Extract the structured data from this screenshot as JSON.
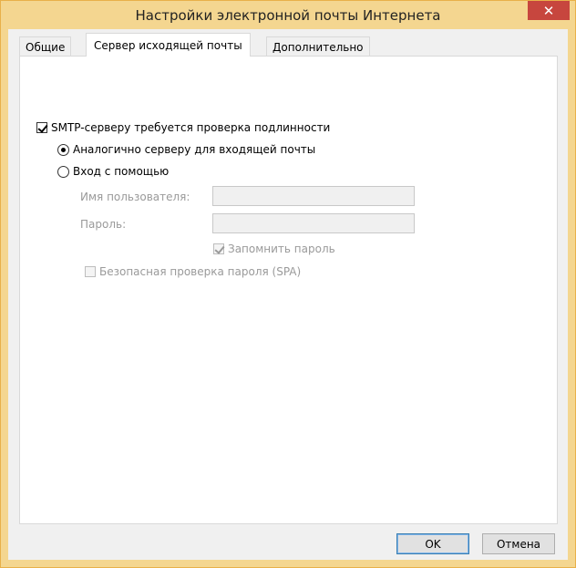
{
  "window": {
    "title": "Настройки электронной почты Интернета",
    "close_label": "✕",
    "accent_color": "#f4d690"
  },
  "tabs": [
    {
      "label": "Общие",
      "active": false
    },
    {
      "label": "Сервер исходящей почты",
      "active": true
    },
    {
      "label": "Дополнительно",
      "active": false
    }
  ],
  "outgoing": {
    "smtp_auth_label": "SMTP-серверу требуется проверка подлинности",
    "smtp_auth_checked": true,
    "same_as_incoming_label": "Аналогично серверу для входящей почты",
    "same_as_incoming_selected": true,
    "login_with_label": "Вход с помощью",
    "login_with_selected": false,
    "username_label": "Имя пользователя:",
    "username_value": "",
    "password_label": "Пароль:",
    "password_value": "",
    "remember_password_label": "Запомнить пароль",
    "remember_password_checked": true,
    "spa_label": "Безопасная проверка пароля (SPA)",
    "spa_checked": false
  },
  "buttons": {
    "ok_label": "OK",
    "cancel_label": "Отмена"
  }
}
